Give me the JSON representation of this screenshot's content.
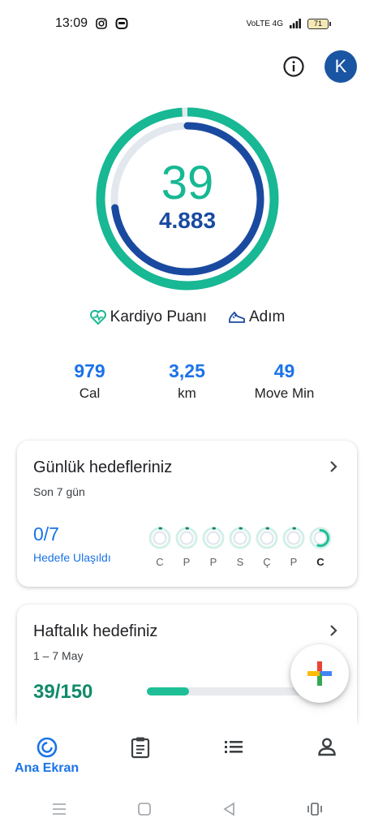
{
  "status_bar": {
    "time": "13:09",
    "network": "VoLTE 4G",
    "battery": "71"
  },
  "header": {
    "avatar_initial": "K"
  },
  "summary": {
    "heart_points": "39",
    "steps": "4.883",
    "heart_points_label": "Kardiyo Puanı",
    "steps_label": "Adım",
    "heart_points_progress": 0.26,
    "steps_progress": 0.73,
    "colors": {
      "heart": "#17b893",
      "steps": "#1a4aa0",
      "track": "#e3e8ef"
    }
  },
  "stats": [
    {
      "value": "979",
      "label": "Cal"
    },
    {
      "value": "3,25",
      "label": "km"
    },
    {
      "value": "49",
      "label": "Move Min"
    }
  ],
  "daily_goals": {
    "title": "Günlük hedefleriniz",
    "subtitle": "Son 7 gün",
    "fraction": "0/7",
    "fraction_label": "Hedefe Ulaşıldı",
    "days": [
      {
        "label": "C",
        "progress": 0.02,
        "today": false
      },
      {
        "label": "P",
        "progress": 0.02,
        "today": false
      },
      {
        "label": "P",
        "progress": 0.02,
        "today": false
      },
      {
        "label": "S",
        "progress": 0.02,
        "today": false
      },
      {
        "label": "Ç",
        "progress": 0.02,
        "today": false
      },
      {
        "label": "P",
        "progress": 0.02,
        "today": false
      },
      {
        "label": "C",
        "progress": 0.55,
        "today": true
      }
    ]
  },
  "weekly_goal": {
    "title": "Haftalık hedefiniz",
    "subtitle": "1 – 7 May",
    "fraction": "39/150",
    "progress": 0.26
  },
  "bottom_nav": {
    "home_label": "Ana Ekran"
  },
  "icons": {
    "info": "info-icon",
    "heart": "heart-icon",
    "shoe": "shoe-icon",
    "add": "add-icon",
    "home": "home-ring-icon",
    "journal": "clipboard-icon",
    "browse": "list-icon",
    "profile": "person-icon"
  }
}
